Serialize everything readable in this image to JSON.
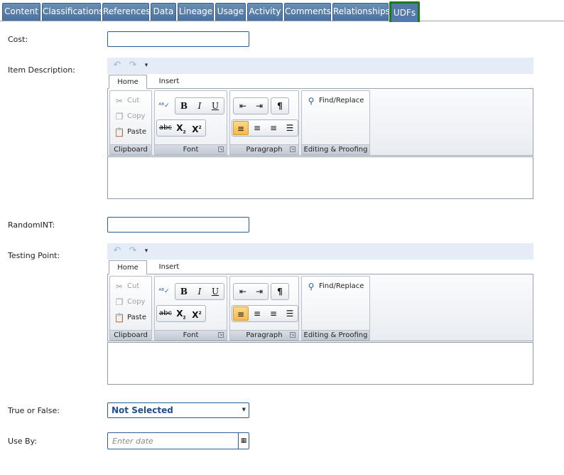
{
  "tabs": [
    {
      "label": "Content"
    },
    {
      "label": "Classifications"
    },
    {
      "label": "References"
    },
    {
      "label": "Data"
    },
    {
      "label": "Lineage"
    },
    {
      "label": "Usage"
    },
    {
      "label": "Activity"
    },
    {
      "label": "Comments"
    },
    {
      "label": "Relationships"
    },
    {
      "label": "UDFs",
      "active": true
    }
  ],
  "fields": {
    "cost": {
      "label": "Cost:",
      "value": ""
    },
    "item_description": {
      "label": "Item Description:"
    },
    "random_int": {
      "label": "RandomINT:",
      "value": ""
    },
    "testing_point": {
      "label": "Testing Point:"
    },
    "true_or_false": {
      "label": "True or False:",
      "selected": "Not Selected"
    },
    "use_by": {
      "label": "Use By:",
      "placeholder": "Enter date"
    }
  },
  "editor": {
    "tabs": [
      "Home",
      "Insert"
    ],
    "clipboard": {
      "title": "Clipboard",
      "cut": "Cut",
      "copy": "Copy",
      "paste": "Paste"
    },
    "font": {
      "title": "Font",
      "bold": "B",
      "italic": "I",
      "underline": "U",
      "strike": "abc",
      "subscript": "X",
      "superscript": "X"
    },
    "paragraph": {
      "title": "Paragraph",
      "pilcrow": "¶"
    },
    "editing": {
      "title": "Editing & Proofing",
      "find_replace": "Find/Replace"
    }
  },
  "colors": {
    "tab_bg": "#5279aa",
    "active_tab_border": "#1b7a1b",
    "input_border": "#2c5f93",
    "selected_text": "#1f4e8c",
    "align_active": "#f7b94b"
  }
}
